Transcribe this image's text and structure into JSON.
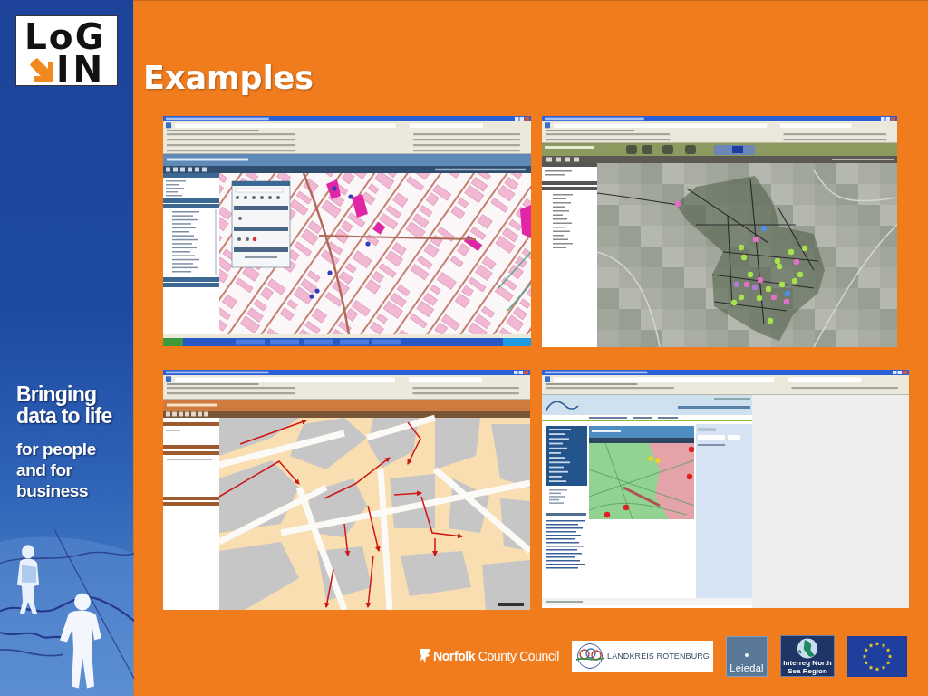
{
  "logo": {
    "line_1": "LoG",
    "line_2": "IN"
  },
  "title": "Examples",
  "tagline": {
    "headline": "Bringing data to life",
    "subline": "for people and for business"
  },
  "screenshots": [
    {
      "kind": "cadastral_map"
    },
    {
      "kind": "aerial_map"
    },
    {
      "kind": "street_map"
    },
    {
      "kind": "web_portal"
    }
  ],
  "partner_logos": [
    {
      "kind": "norfolk",
      "text": "**Norfolk** County Council"
    },
    {
      "kind": "landkreis",
      "text": "LANDKREIS ROTENBURG"
    },
    {
      "kind": "leiedal",
      "text": "Leiedal"
    },
    {
      "kind": "interreg",
      "text": "Interreg North Sea Region"
    },
    {
      "kind": "flag"
    }
  ]
}
